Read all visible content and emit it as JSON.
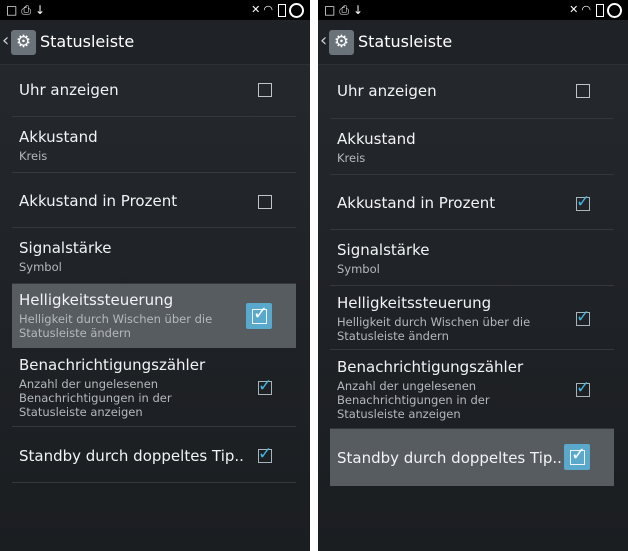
{
  "screens": [
    {
      "header": {
        "back_glyph": "‹",
        "title": "Statusleiste"
      },
      "statusbar": {
        "icons": [
          "square-icon",
          "printer-icon",
          "download-icon",
          "mute-icon",
          "wifi-icon",
          "battery-icon",
          "ring-icon"
        ]
      },
      "items": [
        {
          "title": "Uhr anzeigen",
          "checkbox": "off"
        },
        {
          "title": "Akkustand",
          "summary": "Kreis"
        },
        {
          "title": "Akkustand in Prozent",
          "checkbox": "off"
        },
        {
          "title": "Signalstärke",
          "summary": "Symbol"
        },
        {
          "title": "Helligkeitssteuerung",
          "summary": "Helligkeit durch Wischen über die Statusleiste ändern",
          "checkbox": "on",
          "highlighted": true
        },
        {
          "title": "Benachrichtigungszähler",
          "summary": "Anzahl der ungelesenen Benachrichtigungen in der Statusleiste anzeigen",
          "checkbox": "on"
        },
        {
          "title": "Standby durch doppeltes Tip..",
          "checkbox": "on"
        }
      ]
    },
    {
      "header": {
        "back_glyph": "‹",
        "title": "Statusleiste"
      },
      "statusbar": {
        "icons": [
          "square-icon",
          "printer-icon",
          "download-icon",
          "mute-icon",
          "wifi-icon",
          "battery-icon",
          "ring-icon"
        ]
      },
      "items": [
        {
          "title": "Uhr anzeigen",
          "checkbox": "off"
        },
        {
          "title": "Akkustand",
          "summary": "Kreis"
        },
        {
          "title": "Akkustand in Prozent",
          "checkbox": "on"
        },
        {
          "title": "Signalstärke",
          "summary": "Symbol"
        },
        {
          "title": "Helligkeitssteuerung",
          "summary": "Helligkeit durch Wischen über die Statusleiste ändern",
          "checkbox": "on"
        },
        {
          "title": "Benachrichtigungszähler",
          "summary": "Anzahl der ungelesenen Benachrichtigungen in der Statusleiste anzeigen",
          "checkbox": "on"
        },
        {
          "title": "Standby durch doppeltes Tip..",
          "checkbox": "on",
          "highlighted": true
        }
      ]
    }
  ],
  "colors": {
    "highlight": "#575c61",
    "accent": "#43b3df",
    "background": "#222529"
  }
}
